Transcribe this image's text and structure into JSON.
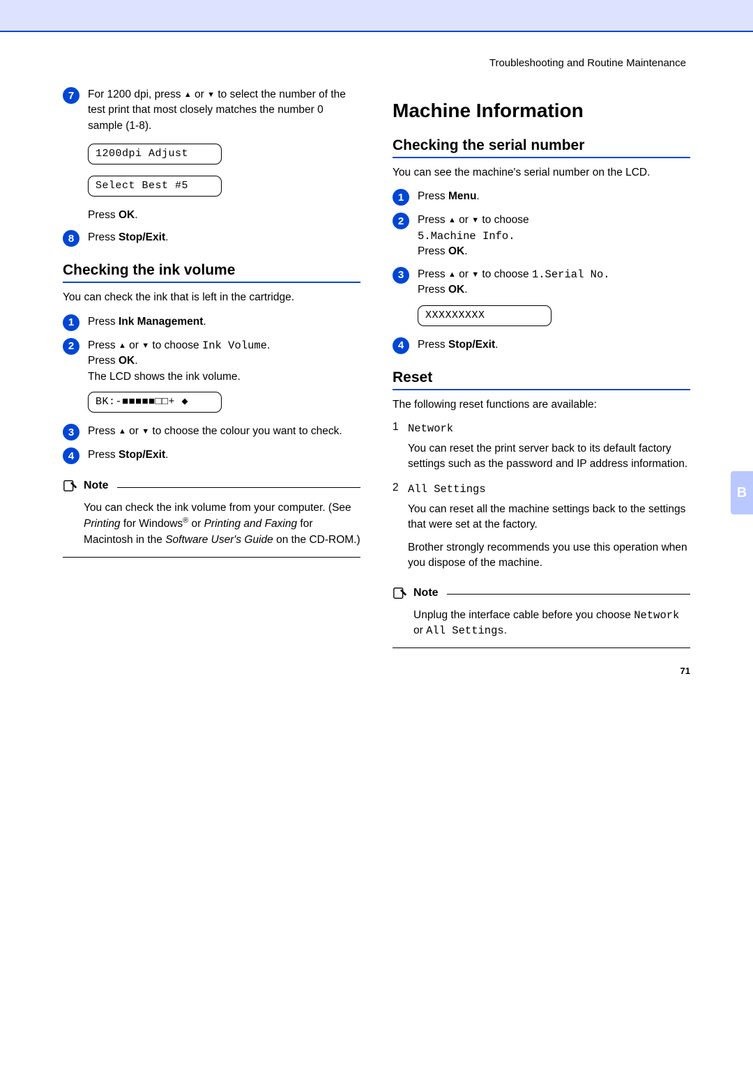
{
  "breadcrumb": "Troubleshooting and Routine Maintenance",
  "left": {
    "step7": {
      "num": "7",
      "text_a": "For 1200 dpi, press ",
      "text_b": " or ",
      "text_c": " to select the number of the test print that most closely matches the number 0 sample (1-8).",
      "lcd1": "1200dpi Adjust",
      "lcd2": "Select Best #5",
      "press_a": "Press ",
      "press_b": "OK",
      "press_c": "."
    },
    "step8": {
      "num": "8",
      "press_a": "Press ",
      "press_b": "Stop/Exit",
      "press_c": "."
    },
    "ink": {
      "heading": "Checking the ink volume",
      "intro": "You can check the ink that is left in the cartridge.",
      "s1": {
        "num": "1",
        "a": "Press ",
        "b": "Ink Management",
        "c": "."
      },
      "s2": {
        "num": "2",
        "a": "Press ",
        "b": " or ",
        "c": " to choose ",
        "mono": "Ink Volume",
        "d": ".",
        "press_a": "Press ",
        "press_b": "OK",
        "press_c": ".",
        "line2": "The LCD shows the ink volume.",
        "lcd": "BK:-■■■■■□□+   ◆"
      },
      "s3": {
        "num": "3",
        "a": "Press ",
        "b": " or ",
        "c": " to choose the colour you want to check."
      },
      "s4": {
        "num": "4",
        "a": "Press ",
        "b": "Stop/Exit",
        "c": "."
      },
      "note": {
        "label": "Note",
        "l1a": "You can check the ink volume from your computer. (See ",
        "l1b": "Printing",
        "l1c": " for Windows",
        "l1d": " or ",
        "l2a": "Printing and Faxing",
        "l2b": " for Macintosh in the ",
        "l3a": "Software User's Guide",
        "l3b": " on the CD-ROM.)"
      }
    }
  },
  "right": {
    "section": "Machine Information",
    "serial": {
      "heading": "Checking the serial number",
      "intro": "You can see the machine's serial number on the LCD.",
      "s1": {
        "num": "1",
        "a": "Press ",
        "b": "Menu",
        "c": "."
      },
      "s2": {
        "num": "2",
        "a": "Press ",
        "b": " or ",
        "c": " to choose",
        "mono": "5.Machine Info.",
        "press_a": "Press ",
        "press_b": "OK",
        "press_c": "."
      },
      "s3": {
        "num": "3",
        "a": "Press ",
        "b": " or ",
        "c": " to choose ",
        "mono": "1.Serial No.",
        "press_a": "Press ",
        "press_b": "OK",
        "press_c": ".",
        "lcd": "XXXXXXXXX"
      },
      "s4": {
        "num": "4",
        "a": "Press ",
        "b": "Stop/Exit",
        "c": "."
      }
    },
    "reset": {
      "heading": "Reset",
      "intro": "The following reset functions are available:",
      "i1": {
        "num": "1",
        "mono": "Network",
        "desc": "You can reset the print server back to its default factory settings such as the password and IP address information."
      },
      "i2": {
        "num": "2",
        "mono": "All Settings",
        "desc1": "You can reset all the machine settings back to the settings that were set at the factory.",
        "desc2": "Brother strongly recommends you use this operation when you dispose of the machine."
      },
      "note": {
        "label": "Note",
        "a": "Unplug the interface cable before you choose ",
        "m1": "Network",
        "b": " or ",
        "m2": "All Settings",
        "c": "."
      }
    }
  },
  "tab": "B",
  "page": "71"
}
